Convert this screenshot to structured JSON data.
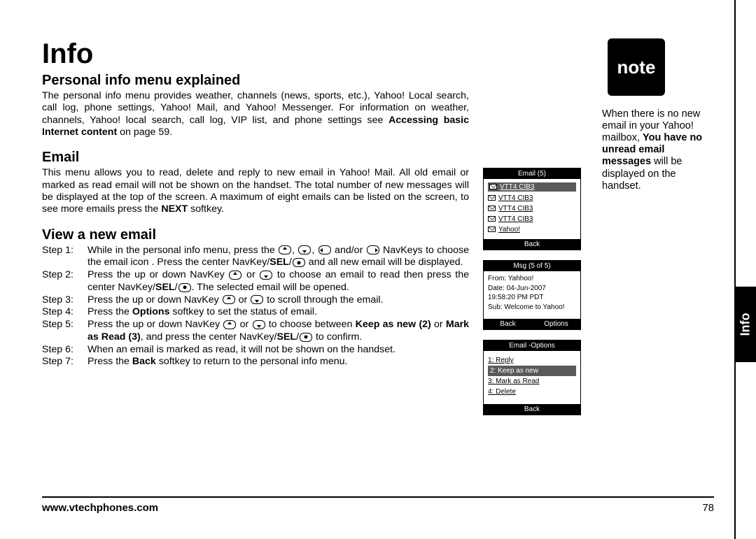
{
  "title": "Info",
  "section1": {
    "heading": "Personal info menu explained",
    "body_a": "The personal info menu provides weather, channels (news, sports, etc.), Yahoo! Local search, call log, phone settings, Yahoo! Mail, and Yahoo! Messenger. For information on weather, channels, Yahoo! local search, call log, VIP list, and phone settings see ",
    "body_bold": "Accessing basic Internet content",
    "body_b": " on page 59."
  },
  "section2": {
    "heading": "Email",
    "body_a": "This menu allows you to read, delete and reply to new email in Yahoo! Mail. All old email or marked as read email will not be shown on the handset. The total number of new messages will be displayed at the top of the screen. A maximum of eight emails can be listed on the screen, to see more emails press the ",
    "body_bold": "NEXT",
    "body_b": " softkey."
  },
  "section3": {
    "heading": "View a new email",
    "steps": [
      {
        "label": "Step 1:",
        "pre": "While in the personal info menu, press the ",
        "mid": " NavKeys  to choose the email icon     . Press the center NavKey/",
        "bold": "SEL",
        "post": " and all new email will be displayed."
      },
      {
        "label": "Step 2:",
        "pre": "Press the up or down NavKey ",
        "mid": " to choose an email to read then press the center NavKey/",
        "bold": "SEL",
        "post": ". The selected email will be opened."
      },
      {
        "label": "Step 3:",
        "pre": "Press the up or down NavKey ",
        "mid": " to scroll through the email.",
        "bold": "",
        "post": ""
      },
      {
        "label": "Step 4:",
        "pre": "Press the ",
        "bold": "Options",
        "post": " softkey to set the status of email."
      },
      {
        "label": "Step 5:",
        "pre": "Press the up or down NavKey ",
        "mid": " to choose between ",
        "bold1": "Keep as new (2)",
        "or": " or ",
        "bold2": "Mark as Read (3)",
        "post": ", and press the center NavKey/",
        "bold3": "SEL",
        "post2": " to confirm."
      },
      {
        "label": "Step 6:",
        "pre": "When an email is marked as read, it will not be shown on the handset."
      },
      {
        "label": "Step 7:",
        "pre": "Press the ",
        "bold": "Back",
        "post": " softkey to return to the personal info menu."
      }
    ]
  },
  "note": {
    "badge": "note",
    "text_a": "When there is no new email in your Yahoo! mailbox, ",
    "bold": "You have no unread email messages",
    "text_b": " will be displayed on the handset."
  },
  "screens": {
    "inbox": {
      "title": "Email (5)",
      "items": [
        "VTT4 CIB3",
        "VTT4 CIB3",
        "VTT4 CIB3",
        "VTT4 CIB3",
        "Yahoo!"
      ],
      "selected_index": 0,
      "footer_left": "Back"
    },
    "message": {
      "title": "Msg (5 of 5)",
      "from": "From: Yahhoo!",
      "date": "Date: 04-Jun-2007",
      "time": "19:58:20 PM PDT",
      "sub": "Sub: Welcome to Yahoo!",
      "footer_left": "Back",
      "footer_right": "Options"
    },
    "options": {
      "title": "Email -Options",
      "items": [
        "1: Reply",
        "2: Keep as new",
        "3: Mark as Read",
        "4: Delete"
      ],
      "selected_index": 1,
      "footer_left": "Back"
    }
  },
  "footer": {
    "url": "www.vtechphones.com",
    "page": "78"
  },
  "sidetab": "Info"
}
